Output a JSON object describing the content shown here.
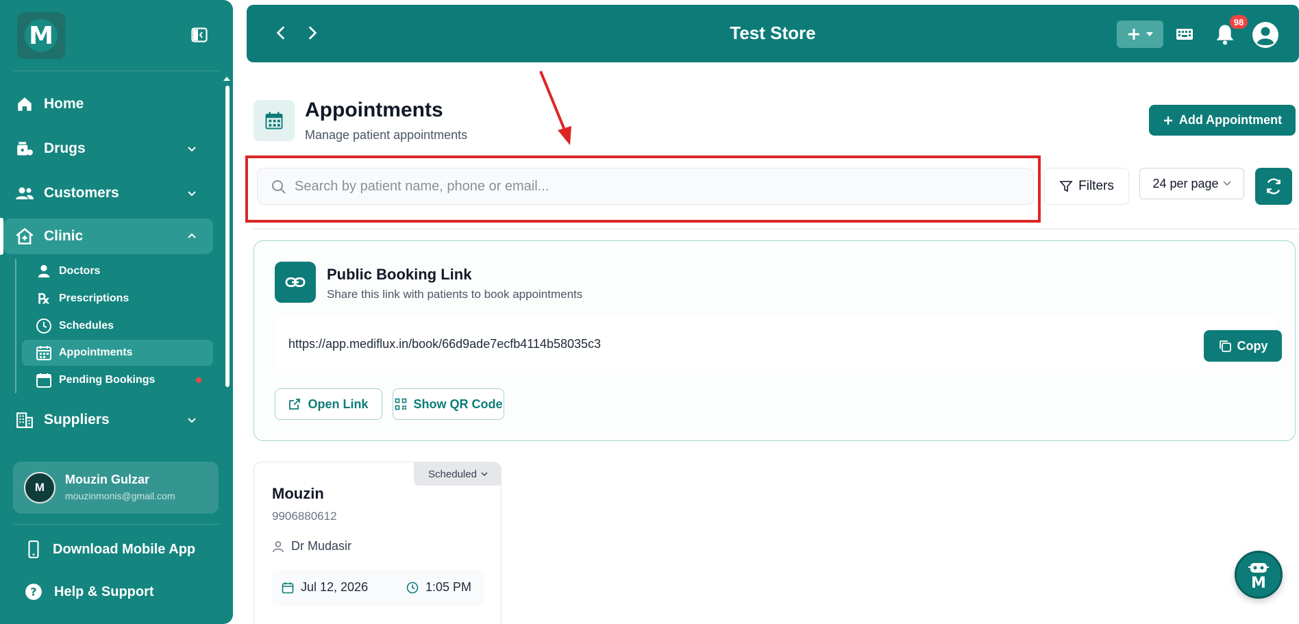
{
  "sidebar": {
    "logo_letter": "M",
    "nav": {
      "home": "Home",
      "drugs": "Drugs",
      "customers": "Customers",
      "clinic": "Clinic",
      "suppliers": "Suppliers"
    },
    "clinic_sub": {
      "doctors": "Doctors",
      "prescriptions": "Prescriptions",
      "schedules": "Schedules",
      "appointments": "Appointments",
      "pending_bookings": "Pending Bookings"
    },
    "user": {
      "initial": "M",
      "name": "Mouzin Gulzar",
      "email": "mouzinmonis@gmail.com"
    },
    "download_app": "Download Mobile App",
    "help": "Help & Support"
  },
  "topbar": {
    "title": "Test Store",
    "notification_count": "98"
  },
  "page": {
    "title": "Appointments",
    "subtitle": "Manage patient appointments",
    "add_button": "Add Appointment"
  },
  "toolbar": {
    "search_placeholder": "Search by patient name, phone or email...",
    "filters_label": "Filters",
    "per_page": "24 per page"
  },
  "booking": {
    "title": "Public Booking Link",
    "subtitle": "Share this link with patients to book appointments",
    "url": "https://app.mediflux.in/book/66d9ade7ecfb4114b58035c3",
    "copy_label": "Copy",
    "open_label": "Open Link",
    "qr_label": "Show QR Code"
  },
  "appointments": [
    {
      "status": "Scheduled",
      "name": "Mouzin",
      "phone": "9906880612",
      "doctor": "Dr Mudasir",
      "date": "Jul 12, 2026",
      "time": "1:05 PM"
    }
  ],
  "colors": {
    "brand": "#0d7c78",
    "sidebar": "#14857f",
    "badge": "#ef4444",
    "annotation": "#dc2626"
  }
}
